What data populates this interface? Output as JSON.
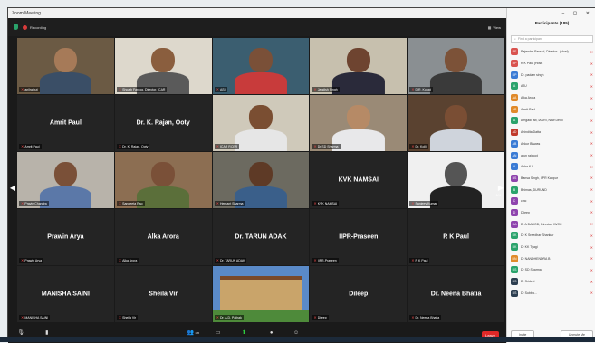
{
  "window": {
    "title": "Zoom Meeting",
    "recording_label": "Recording",
    "view_label": "View"
  },
  "tiles": [
    {
      "label": "anilrajput",
      "big": "",
      "video": true,
      "speaking": false,
      "bg": "#6b5a44",
      "skin": "#a67a58",
      "shirt": "#3a4e66"
    },
    {
      "label": "Shoaib Farooq, Director, ICAR",
      "big": "",
      "video": true,
      "speaking": false,
      "bg": "#ddd8cc",
      "skin": "#8a5e3e",
      "shirt": "#5a5a5a"
    },
    {
      "label": "ASI",
      "big": "",
      "video": true,
      "speaking": false,
      "bg": "#3b5e70",
      "skin": "#7a5038",
      "shirt": "#c83b3b"
    },
    {
      "label": "Jagdish Singh",
      "big": "",
      "video": true,
      "speaking": true,
      "bg": "#c7c0ae",
      "skin": "#6e4430",
      "shirt": "#2a2a3a"
    },
    {
      "label": "DIR, Kohat",
      "big": "",
      "video": true,
      "speaking": false,
      "bg": "#8a8f92",
      "skin": "#7c5238",
      "shirt": "#3a3a3a"
    },
    {
      "label": "Amrit Paul",
      "big": "Amrit Paul",
      "video": false,
      "speaking": false
    },
    {
      "label": "Dr. K. Rajan, Ooty",
      "big": "Dr. K. Rajan, Ooty",
      "video": false,
      "speaking": false
    },
    {
      "label": "ICAR RCER",
      "big": "",
      "video": true,
      "speaking": false,
      "bg": "#cfc9ba",
      "skin": "#7a4e32",
      "shirt": "#e6e6e6"
    },
    {
      "label": "Dr SD Sharma",
      "big": "",
      "video": true,
      "speaking": false,
      "bg": "#9a8a76",
      "skin": "#b68a66",
      "shirt": "#e8e8ea"
    },
    {
      "label": "Dr. Kolli",
      "big": "",
      "video": true,
      "speaking": false,
      "bg": "#5a4230",
      "skin": "#7a4e34",
      "shirt": "#cfd4dc"
    },
    {
      "label": "Pravin Chandra",
      "big": "",
      "video": true,
      "speaking": false,
      "bg": "#b8b3aa",
      "skin": "#7a5038",
      "shirt": "#5b78a8"
    },
    {
      "label": "Sangeeta Rao",
      "big": "",
      "video": true,
      "speaking": false,
      "bg": "#8c6e52",
      "skin": "#7a5038",
      "shirt": "#5b6f3a"
    },
    {
      "label": "Hemant Sharma",
      "big": "",
      "video": true,
      "speaking": false,
      "bg": "#6c6a60",
      "skin": "#5e3a26",
      "shirt": "#3a5f8a"
    },
    {
      "label": "KVK NAMSAI",
      "big": "KVK NAMSAI",
      "video": false,
      "speaking": false
    },
    {
      "label": "Sanjeev Kumar",
      "big": "",
      "video": true,
      "speaking": false,
      "bg": "#f0f0f0",
      "skin": "#555555",
      "shirt": "#222222"
    },
    {
      "label": "Prawin Arya",
      "big": "Prawin Arya",
      "video": false,
      "speaking": false
    },
    {
      "label": "Alka Arora",
      "big": "Alka Arora",
      "video": false,
      "speaking": false
    },
    {
      "label": "Dr. TARUN ADAK",
      "big": "Dr. TARUN ADAK",
      "video": false,
      "speaking": false
    },
    {
      "label": "IIPR-Praseen",
      "big": "IIPR-Praseen",
      "video": false,
      "speaking": false
    },
    {
      "label": "R K Paul",
      "big": "R K Paul",
      "video": false,
      "speaking": false
    },
    {
      "label": "MANISHA SAINI",
      "big": "MANISHA SAINI",
      "video": false,
      "speaking": false
    },
    {
      "label": "Sheila Vir",
      "big": "Sheila Vir",
      "video": false,
      "speaking": false
    },
    {
      "label": "Dr. A.D. Pathak",
      "big": "",
      "video": true,
      "speaking": false,
      "building": true,
      "bg": "#5a8ac8"
    },
    {
      "label": "Dileep",
      "big": "Dileep",
      "video": false,
      "speaking": false
    },
    {
      "label": "Dr. Neena Bhatia",
      "big": "Dr. Neena Bhatia",
      "video": false,
      "speaking": false
    }
  ],
  "pager": {
    "page": "1/4"
  },
  "toolbar": {
    "items": [
      {
        "label": "Unmute",
        "icon": "mic-off-icon"
      },
      {
        "label": "Stop Video",
        "icon": "video-icon"
      },
      {
        "label": "Participants",
        "icon": "participants-icon",
        "count": "185"
      },
      {
        "label": "Chat",
        "icon": "chat-icon"
      },
      {
        "label": "Share Screen",
        "icon": "share-screen-icon"
      },
      {
        "label": "Record",
        "icon": "record-icon"
      },
      {
        "label": "Reactions",
        "icon": "reactions-icon"
      }
    ],
    "end_label": "Leave"
  },
  "panel": {
    "title": "Participants (185)",
    "search_placeholder": "Find a participant",
    "participants": [
      {
        "initials": "RF",
        "name": "Rajender Parsad, Director...(Host)",
        "color": "#d9534f"
      },
      {
        "initials": "RP",
        "name": "R K Paul (Host)",
        "color": "#d9534f"
      },
      {
        "initials": "DP",
        "name": "Dr. padam singh",
        "color": "#3a7bd5"
      },
      {
        "initials": "A",
        "name": "AJU",
        "color": "#2aa36b"
      },
      {
        "initials": "AA",
        "name": "Alka Arora",
        "color": "#e08a2a"
      },
      {
        "initials": "AP",
        "name": "Amrit Paul",
        "color": "#e08a2a"
      },
      {
        "initials": "A",
        "name": "Amgadi lab, IASRI, New Delhi",
        "color": "#2aa36b"
      },
      {
        "initials": "AD",
        "name": "Anindita Datta",
        "color": "#c0392b"
      },
      {
        "initials": "AB",
        "name": "Ankur Biswas",
        "color": "#3a7bd5"
      },
      {
        "initials": "AN",
        "name": "arun rajpoot",
        "color": "#3a7bd5"
      },
      {
        "initials": "A",
        "name": "Asha K I",
        "color": "#3a7bd5"
      },
      {
        "initials": "BS",
        "name": "Bansa Singh, IIPR Kanpur",
        "color": "#8e44ad"
      },
      {
        "initials": "B",
        "name": "Bhimas, DURUND",
        "color": "#2aa36b"
      },
      {
        "initials": "C",
        "name": "cmc",
        "color": "#8e44ad"
      },
      {
        "initials": "D",
        "name": "Dileep",
        "color": "#8e44ad"
      },
      {
        "initials": "DA",
        "name": "Dr A DAHOD, Director, IWCC",
        "color": "#8e44ad"
      },
      {
        "initials": "DK",
        "name": "Dr K Sreedhar Shankar",
        "color": "#2aa36b"
      },
      {
        "initials": "DK",
        "name": "Dr KK Tyagi",
        "color": "#2aa36b"
      },
      {
        "initials": "DN",
        "name": "Dr NANDHENDRA B",
        "color": "#e08a2a"
      },
      {
        "initials": "DS",
        "name": "Dr SD Sharma",
        "color": "#2aa36b"
      },
      {
        "initials": "DS",
        "name": "Dr Srideci",
        "color": "#2c3e50"
      },
      {
        "initials": "DS",
        "name": "Dr Subba...",
        "color": "#2c3e50"
      }
    ],
    "invite_label": "Invite",
    "unmute_label": "Unmute Me"
  }
}
